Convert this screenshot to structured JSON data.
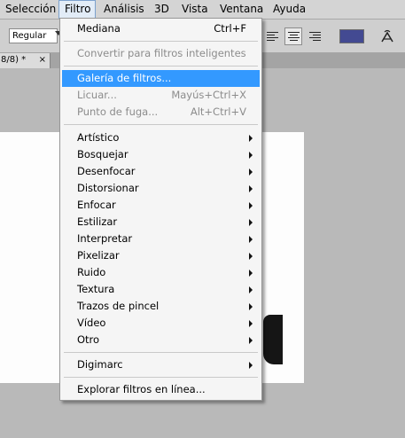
{
  "menubar": {
    "items": [
      "Selección",
      "Filtro",
      "Análisis",
      "3D",
      "Vista",
      "Ventana",
      "Ayuda"
    ]
  },
  "options": {
    "font_style": "Regular",
    "text_color": "#434a92"
  },
  "document": {
    "tab_title": "8/8) *",
    "close": "×"
  },
  "filter_menu": {
    "last_filter": {
      "label": "Mediana",
      "shortcut": "Ctrl+F"
    },
    "smart_filters": {
      "label": "Convertir para filtros inteligentes"
    },
    "filter_gallery": {
      "label": "Galería de filtros..."
    },
    "liquify": {
      "label": "Licuar...",
      "shortcut": "Mayús+Ctrl+X"
    },
    "vanishing_point": {
      "label": "Punto de fuga...",
      "shortcut": "Alt+Ctrl+V"
    },
    "submenus": [
      "Artístico",
      "Bosquejar",
      "Desenfocar",
      "Distorsionar",
      "Enfocar",
      "Estilizar",
      "Interpretar",
      "Pixelizar",
      "Ruido",
      "Textura",
      "Trazos de pincel",
      "Vídeo",
      "Otro"
    ],
    "digimarc": {
      "label": "Digimarc"
    },
    "browse_online": {
      "label": "Explorar filtros en línea..."
    }
  },
  "colors": {
    "highlight": "#3399ff",
    "menu_bg": "#f5f5f5",
    "disabled_text": "#8c8c8c"
  }
}
